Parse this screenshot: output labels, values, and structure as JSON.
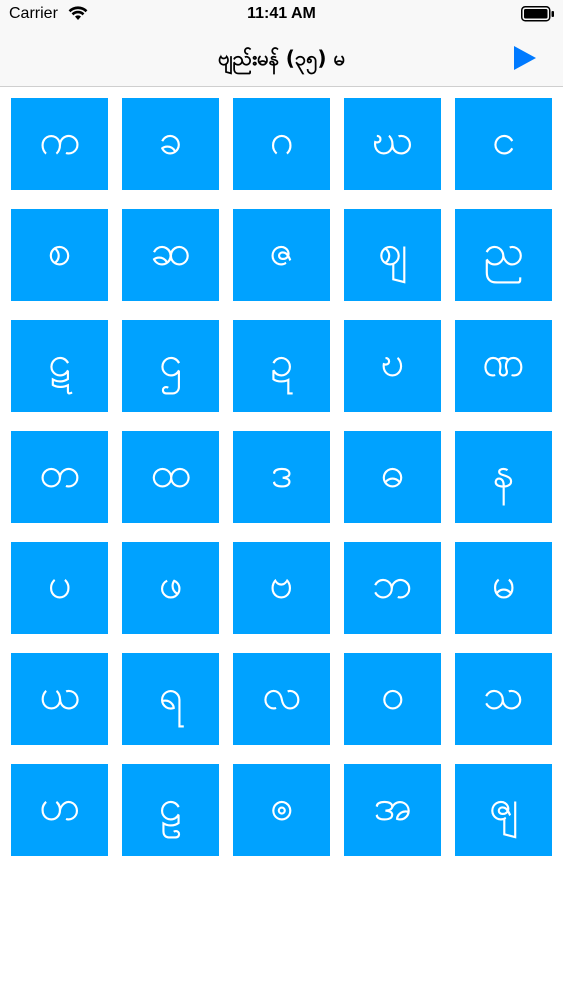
{
  "status_bar": {
    "carrier": "Carrier",
    "time": "11:41 AM",
    "icons": [
      "wifi-icon",
      "battery-icon"
    ]
  },
  "nav": {
    "title": "ဗျည်းမန် (၃၅) မ",
    "play_icon": "play-icon",
    "accent_color": "#007aff"
  },
  "tile_color": "#00a2ff",
  "letters": [
    "က",
    "ခ",
    "ဂ",
    "ဃ",
    "င",
    "စ",
    "ဆ",
    "ဇ",
    "ဈ",
    "ည",
    "ဋ",
    "ဌ",
    "ဍ",
    "ဎ",
    "ဏ",
    "တ",
    "ထ",
    "ဒ",
    "ဓ",
    "န",
    "ပ",
    "ဖ",
    "ဗ",
    "ဘ",
    "မ",
    "ယ",
    "ရ",
    "လ",
    "ဝ",
    "သ",
    "ဟ",
    "ဠ",
    "ၜ",
    "အ",
    "ၛ"
  ]
}
